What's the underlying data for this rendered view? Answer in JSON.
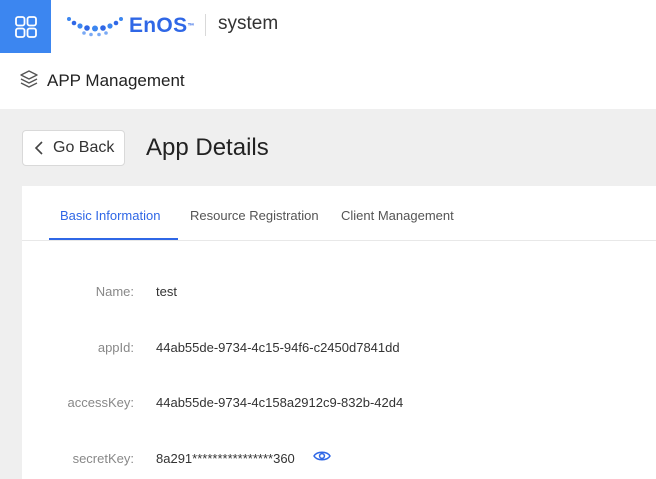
{
  "topbar": {
    "app_menu_icon": "grid-icon",
    "logo_text": "EnOS",
    "logo_tm": "™",
    "workspace": "system"
  },
  "subheader": {
    "icon": "stack-icon",
    "title": "APP Management"
  },
  "page": {
    "back_label": "Go Back",
    "title": "App Details"
  },
  "tabs": [
    {
      "label": "Basic Information",
      "active": true
    },
    {
      "label": "Resource Registration",
      "active": false
    },
    {
      "label": "Client Management",
      "active": false
    }
  ],
  "fields": [
    {
      "label": "Name:",
      "value": "test"
    },
    {
      "label": "appId:",
      "value": "44ab55de-9734-4c15-94f6-c2450d7841dd"
    },
    {
      "label": "accessKey:",
      "value": "44ab55de-9734-4c158a2912c9-832b-42d4"
    },
    {
      "label": "secretKey:",
      "value": "8a291****************360"
    }
  ],
  "colors": {
    "accent": "#2f67e6",
    "app_menu_bg": "#3c86f0"
  }
}
